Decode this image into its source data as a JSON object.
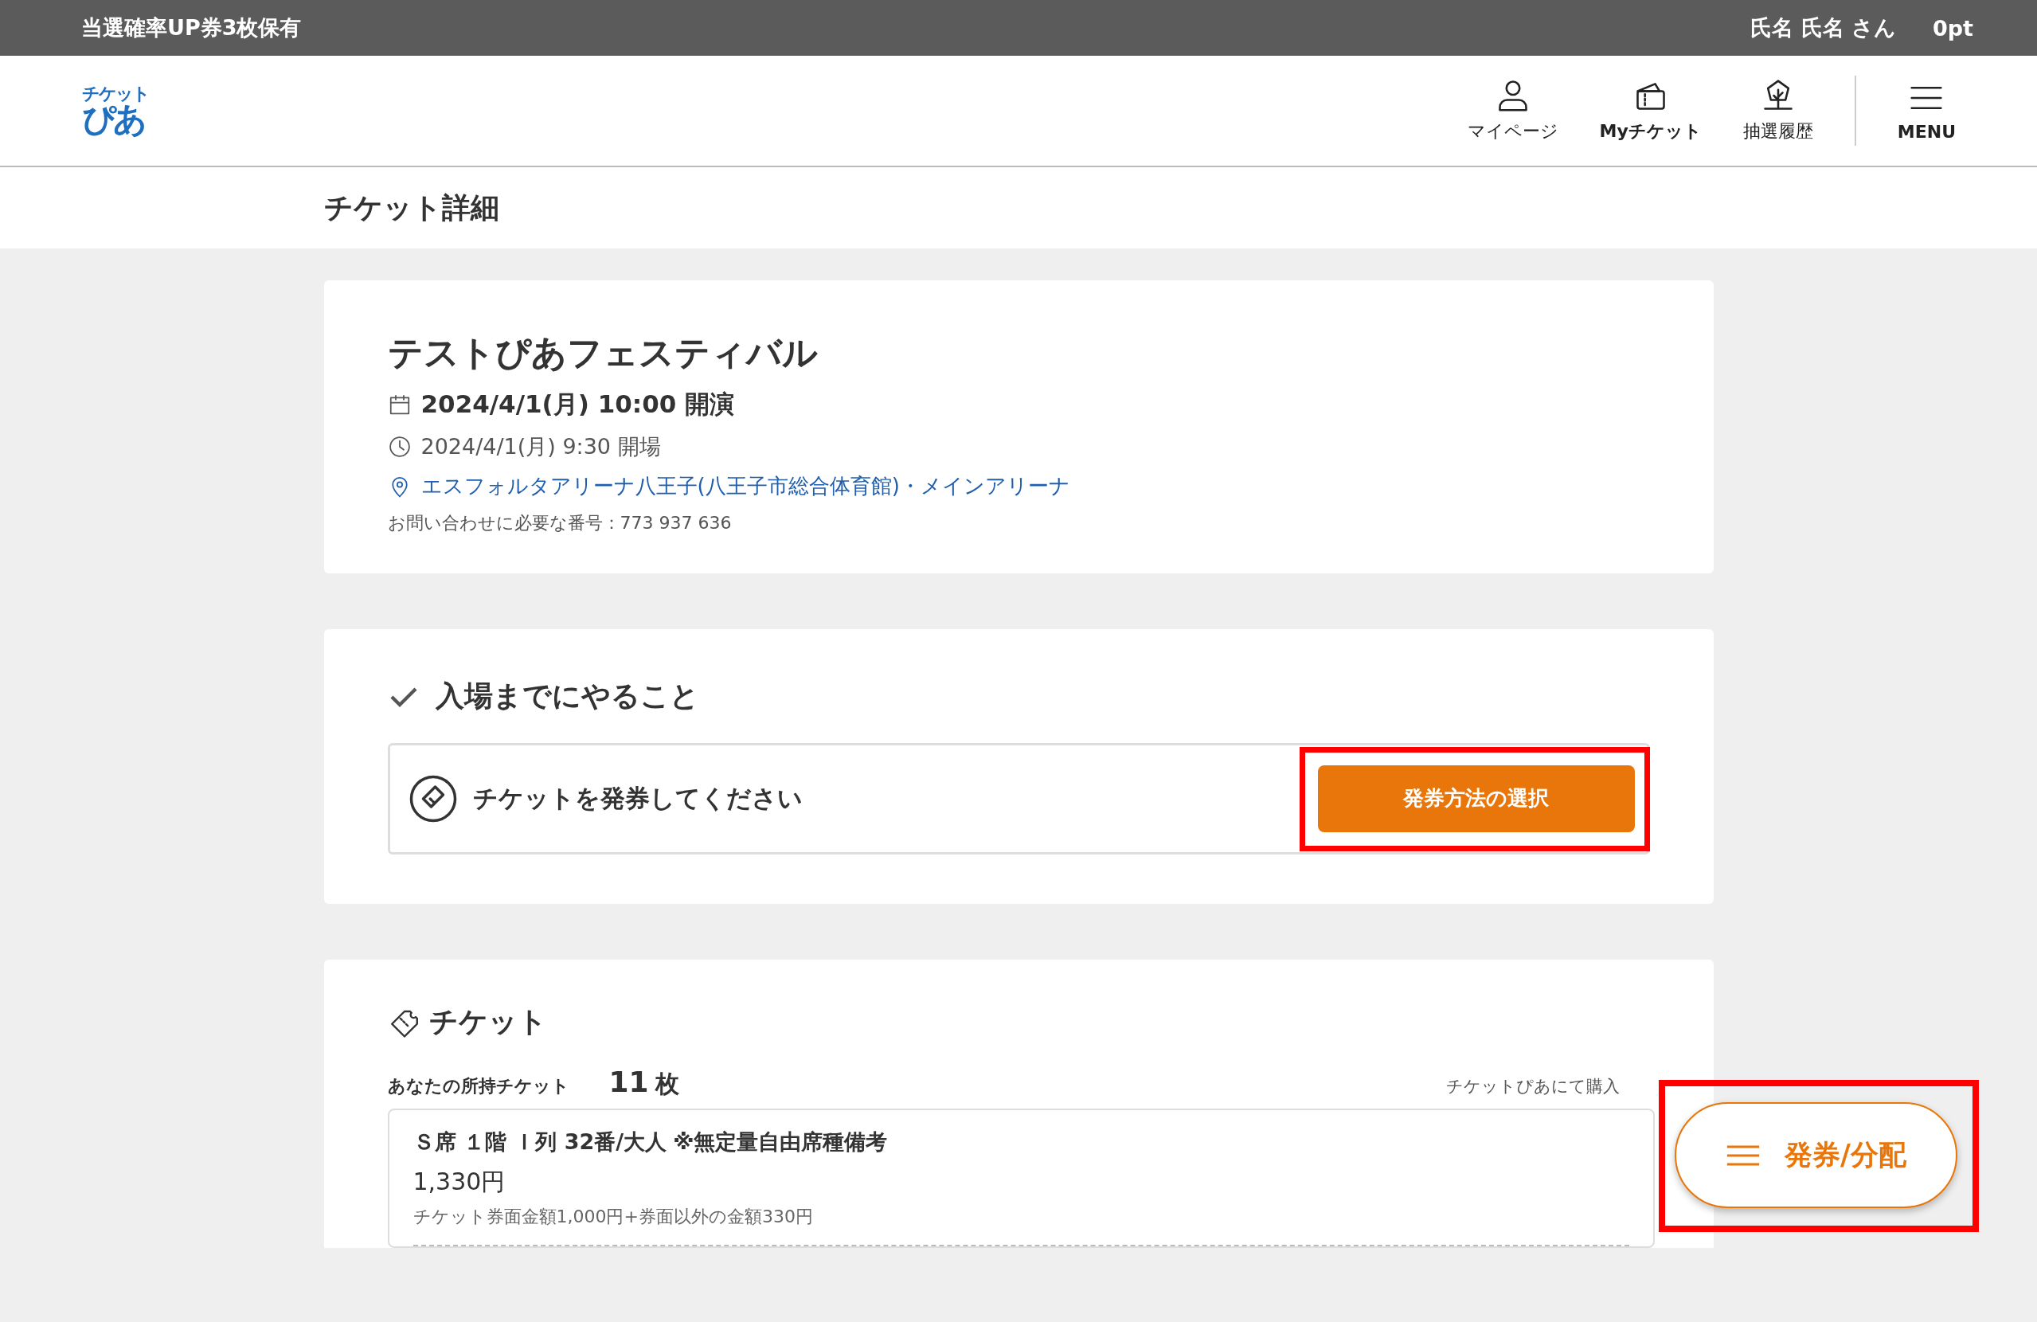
{
  "top_bar": {
    "promo": "当選確率UP券3枚保有",
    "user_name": "氏名 氏名 さん",
    "points": "0pt"
  },
  "header": {
    "logo": [
      "チケット",
      "ぴあ"
    ],
    "nav": [
      {
        "label": "マイページ",
        "kind": "person"
      },
      {
        "label": "Myチケット",
        "kind": "ticket"
      },
      {
        "label": "抽選履歴",
        "kind": "lottery"
      },
      {
        "label": "MENU",
        "kind": "menu"
      }
    ]
  },
  "page_title": "チケット詳細",
  "event": {
    "title": "テストぴあフェスティバル",
    "start": "2024/4/1(月) 10:00 開演",
    "open": "2024/4/1(月) 9:30 開場",
    "venue": "エスフォルタアリーナ八王子(八王子市総合体育館)・メインアリーナ",
    "inquiry": "お問い合わせに必要な番号：773 937 636"
  },
  "todo": {
    "heading": "入場までにやること",
    "items": [
      {
        "text": "チケットを発券してください",
        "button": "発券方法の選択",
        "highlighted": true
      }
    ]
  },
  "tickets": {
    "heading": "チケット",
    "owned_label": "あなたの所持チケット",
    "count": "11",
    "unit": "枚",
    "source": "チケットぴあにて購入",
    "items": [
      {
        "seat": "Ｓ席 １階 Ｉ列 32番/大人",
        "note": "※無定量自由席種備考",
        "price": "1,330円",
        "breakdown": "チケット券面金額1,000円+券面以外の金額330円"
      }
    ]
  },
  "fab": {
    "label": "発券/分配",
    "highlighted": true
  }
}
